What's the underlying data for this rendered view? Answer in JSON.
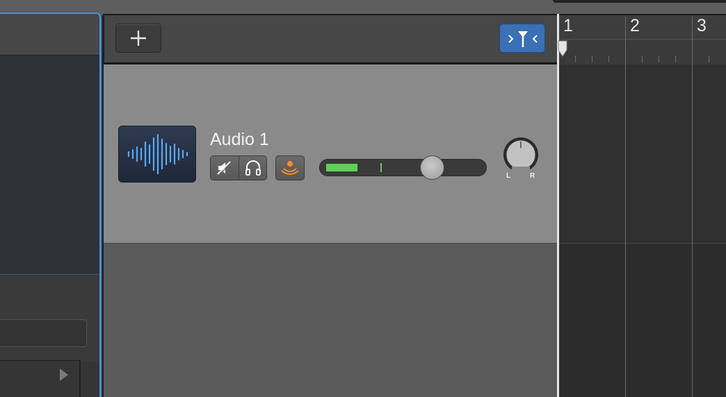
{
  "toolbar": {
    "add_track_icon": "plus-icon",
    "catch_icon": "playhead-catch-icon",
    "catch_active": true
  },
  "track": {
    "name": "Audio 1",
    "icon": "waveform-icon",
    "mute_icon": "speaker-mute-icon",
    "solo_icon": "headphones-icon",
    "record_arm_icon": "input-monitor-icon",
    "volume_level": 0.67,
    "meter_level": 0.2,
    "meter_peak": 0.35,
    "pan": 0.0,
    "pan_left_label": "L",
    "pan_right_label": "R"
  },
  "ruler": {
    "bars": [
      "1",
      "2",
      "3"
    ]
  },
  "colors": {
    "accent_blue": "#3b6fb6",
    "selection_border": "#4a90d9",
    "meter_green": "#5fcf5a",
    "waveform_blue": "#5aa9f0",
    "arm_orange": "#f0902c"
  }
}
